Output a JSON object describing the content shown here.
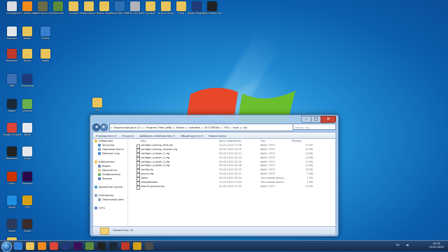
{
  "desktop": {
    "icons": [
      {
        "label": "сценарий",
        "color": "#d8dce2"
      },
      {
        "label": "VLC media player",
        "color": "#f08a1c"
      },
      {
        "label": "Wolfenstein Call of ...",
        "color": "#6b6b4a"
      },
      {
        "label": "Minecraft",
        "color": "#5a8c3c"
      },
      {
        "label": "музыка",
        "color": "#e8c45a"
      },
      {
        "label": "Новая папка (3)",
        "color": "#e8c45a"
      },
      {
        "label": "Новая папка",
        "color": "#e8c45a"
      },
      {
        "label": "OpenOffice 4.1.6",
        "color": "#2f6fb3"
      },
      {
        "label": "META-184 ABCBATS...",
        "color": "#b0b4ba"
      },
      {
        "label": "музыка",
        "color": "#e8c45a"
      },
      {
        "label": "игры и игры",
        "color": "#e8c45a"
      },
      {
        "label": "Help",
        "color": "#e8c45a"
      },
      {
        "label": "Adobe Photoshop CC (32)",
        "color": "#1e3a78"
      },
      {
        "label": "Epic Games Launcher",
        "color": "#222222"
      },
      {
        "label": "Корзина",
        "color": "#e3e7ec"
      },
      {
        "label": "видео",
        "color": "#e8c45a"
      },
      {
        "label": "Firefox",
        "color": "#3a7ed0"
      },
      {
        "label": "Bandicam",
        "color": "#c0392b"
      },
      {
        "label": "Новая",
        "color": "#e8c45a"
      },
      {
        "label": "новая",
        "color": "#e8c45a"
      },
      {
        "label": "VPN",
        "color": "#3b6fb6"
      },
      {
        "label": "Photoshop",
        "color": "#1e3a78"
      },
      {
        "label": "Steam",
        "color": "#1b2838"
      },
      {
        "label": "uTorrent",
        "color": "#6ab04c"
      },
      {
        "label": "Google Chrome",
        "color": "#db4437"
      },
      {
        "label": "Word",
        "color": "#e3e7ec"
      },
      {
        "label": "Bandicam",
        "color": "#222222"
      },
      {
        "label": "Excel",
        "color": "#e3e7ec"
      },
      {
        "label": "Unity",
        "color": "#cc3300"
      },
      {
        "label": "Premiere",
        "color": "#2a0a4a"
      },
      {
        "label": "Skype",
        "color": "#1d8fe0"
      },
      {
        "label": "GTA",
        "color": "#d4a017"
      },
      {
        "label": "Game",
        "color": "#2b3a5a"
      },
      {
        "label": "Game",
        "color": "#3a2a2a"
      },
      {
        "label": "Новая",
        "color": "#e8c45a"
      }
    ],
    "cfg_folder_label": "cfg"
  },
  "explorer": {
    "address": [
      "Локальный диск (C:)",
      "Program Files (x86)",
      "Steam",
      "userdata",
      "251708164",
      "730",
      "local",
      "cfg"
    ],
    "search_placeholder": "Поиск: cfg",
    "toolbar": {
      "organize": "Упорядочить ▾",
      "open": "Открыть",
      "library": "Добавить в библиотеку ▾",
      "share": "Общий доступ ▾",
      "new_folder": "Новая папка"
    },
    "nav": [
      {
        "label": "Избранное",
        "icon": "star-icon",
        "color": "#e8c45a",
        "level": 0
      },
      {
        "label": "Загрузки",
        "icon": "downloads-icon",
        "color": "#5b8bc8",
        "level": 1
      },
      {
        "label": "Недавние места",
        "icon": "recent-icon",
        "color": "#7fa6cc",
        "level": 1
      },
      {
        "label": "Рабочий стол",
        "icon": "desktop-icon",
        "color": "#4b8ad0",
        "level": 1
      },
      {
        "label": "",
        "icon": "",
        "color": "",
        "level": -1
      },
      {
        "label": "Библиотеки",
        "icon": "library-icon",
        "color": "#e8c45a",
        "level": 0
      },
      {
        "label": "Видео",
        "icon": "video-icon",
        "color": "#6d8fb8",
        "level": 1
      },
      {
        "label": "Документы",
        "icon": "documents-icon",
        "color": "#d9c38a",
        "level": 1
      },
      {
        "label": "Изображения",
        "icon": "images-icon",
        "color": "#6cac6c",
        "level": 1
      },
      {
        "label": "Музыка",
        "icon": "music-icon",
        "color": "#5a7fc0",
        "level": 1
      },
      {
        "label": "",
        "icon": "",
        "color": "",
        "level": -1
      },
      {
        "label": "Домашняя группа",
        "icon": "homegroup-icon",
        "color": "#4aa0d8",
        "level": 0
      },
      {
        "label": "",
        "icon": "",
        "color": "",
        "level": -1
      },
      {
        "label": "Компьютер",
        "icon": "computer-icon",
        "color": "#8ea7c4",
        "level": 0
      },
      {
        "label": "Локальный диск",
        "icon": "drive-icon",
        "color": "#9aa4b0",
        "level": 1
      },
      {
        "label": "",
        "icon": "",
        "color": "",
        "level": -1
      },
      {
        "label": "Сеть",
        "icon": "network-icon",
        "color": "#5b8bc8",
        "level": 0
      }
    ],
    "columns": {
      "name": "Имя",
      "date": "Дата изменения",
      "type": "Тип",
      "size": "Размер"
    },
    "files": [
      {
        "name": "configen_backup_first.cfg",
        "date": "13.01.2019 17:28",
        "type": "Файл \"CFG\"",
        "size": "13 КБ"
      },
      {
        "name": "configen_backup_session.cfg",
        "date": "20.02.2019 22:15",
        "type": "Файл \"CFG\"",
        "size": "13 КБ"
      },
      {
        "name": "configen_custom_1.cfg",
        "date": "09.02.2019 22:21",
        "type": "Файл \"CFG\"",
        "size": "13 КБ"
      },
      {
        "name": "configen_custom_2.cfg",
        "date": "09.02.2019 22:23",
        "type": "Файл \"CFG\"",
        "size": "13 КБ"
      },
      {
        "name": "configen_custom_3.cfg",
        "date": "09.02.2019 22:25",
        "type": "Файл \"CFG\"",
        "size": "13 КБ"
      },
      {
        "name": "configen_custom_5.cfg",
        "date": "09.02.2019 22:28",
        "type": "Файл \"CFG\"",
        "size": "13 КБ"
      },
      {
        "name": "config.cfg",
        "date": "20.02.2019 22:15",
        "type": "Файл \"CFG\"",
        "size": "13 КБ"
      },
      {
        "name": "joyxxx.cfg",
        "date": "20.02.2019 22:21",
        "type": "Файл \"CFG\"",
        "size": "1 КБ"
      },
      {
        "name": "video",
        "date": "20.02.2019 20:43",
        "type": "Текстовый докум...",
        "size": "1 КБ"
      },
      {
        "name": "videodefaults",
        "date": "13.01.2019 17:03",
        "type": "Текстовый докум...",
        "size": "1 КБ"
      },
      {
        "name": "share3_backup.cfg",
        "date": "20.02.2019 11:44",
        "type": "Файл \"CFG\"",
        "size": "13 КБ"
      }
    ],
    "status": "Элементов: 10"
  },
  "taskbar": {
    "apps": [
      {
        "name": "internet-explorer-icon",
        "color": "#2f7fd6"
      },
      {
        "name": "folder-icon",
        "color": "#e8c45a"
      },
      {
        "name": "media-player-icon",
        "color": "#f08a1c"
      },
      {
        "name": "chrome-icon",
        "color": "#db4437"
      },
      {
        "name": "photoshop-icon",
        "color": "#1e3a78"
      },
      {
        "name": "premiere-icon",
        "color": "#3a0f5a"
      },
      {
        "name": "minecraft-icon",
        "color": "#5a8c3c"
      },
      {
        "name": "unity-icon",
        "color": "#222222"
      },
      {
        "name": "steam-icon",
        "color": "#1b2838"
      },
      {
        "name": "bandicam-icon",
        "color": "#c0392b"
      },
      {
        "name": "csgo-icon",
        "color": "#d4a017"
      },
      {
        "name": "app-icon",
        "color": "#4a4a4a"
      }
    ],
    "lang": "RU",
    "time": "22:32",
    "date": "20.02.2019"
  }
}
